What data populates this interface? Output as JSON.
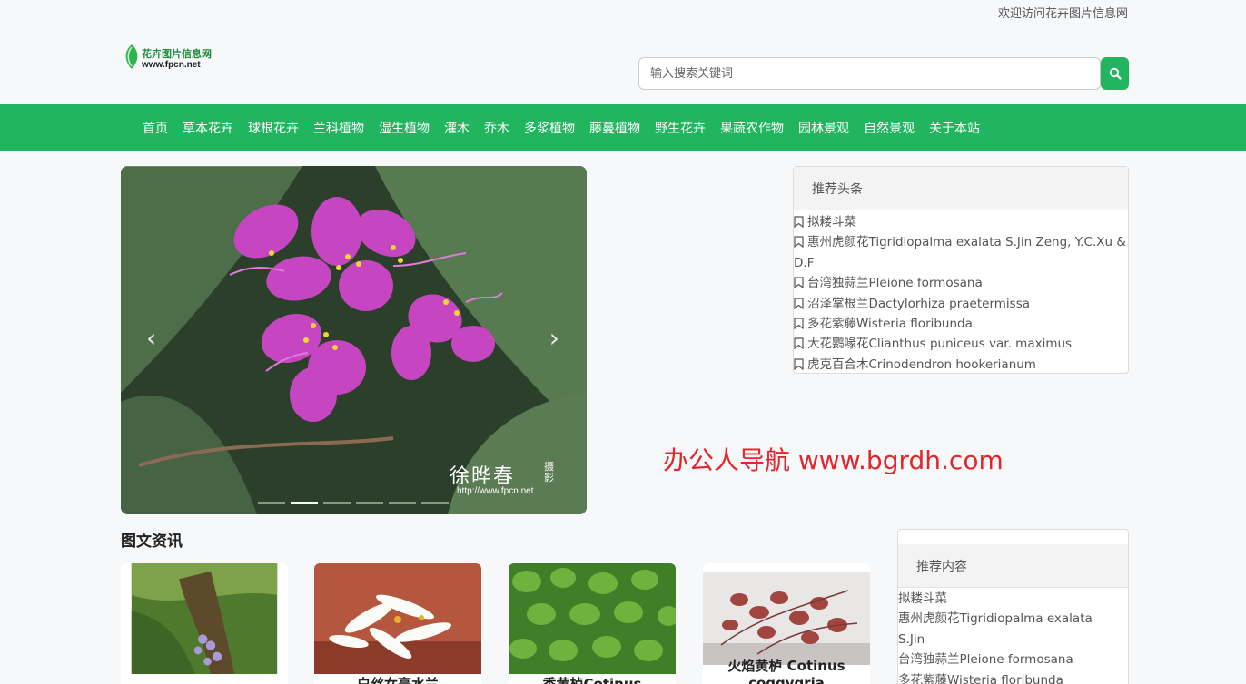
{
  "topbar": {
    "welcome": "欢迎访问花卉图片信息网"
  },
  "logo": {
    "name_cn": "花卉图片信息网",
    "domain": "www.fpcn.net"
  },
  "search": {
    "placeholder": "输入搜索关键词",
    "icon": "search-icon"
  },
  "nav": [
    "首页",
    "草本花卉",
    "球根花卉",
    "兰科植物",
    "湿生植物",
    "灌木",
    "乔木",
    "多浆植物",
    "藤蔓植物",
    "野生花卉",
    "果蔬农作物",
    "园林景观",
    "自然景观",
    "关于本站"
  ],
  "carousel": {
    "prev_icon": "chevron-left-icon",
    "next_icon": "chevron-right-icon",
    "watermark": "徐晔春",
    "watermark_mark": "摄影",
    "watermark_url": "http://www.fpcn.net",
    "slide_count": 6,
    "active_index": 1
  },
  "promo": "办公人导航 www.bgrdh.com",
  "headlines": {
    "title": "推荐头条",
    "items": [
      "拟耧斗菜",
      "惠州虎颜花Tigridiopalma exalata S.Jin Zeng, Y.C.Xu & D.F",
      "台湾独蒜兰Pleione formosana",
      "沼泽掌根兰Dactylorhiza praetermissa",
      "多花紫藤Wisteria floribunda",
      "大花鹦喙花Clianthus puniceus var. maximus",
      "虎克百合木Crinodendron hookerianum"
    ]
  },
  "news": {
    "title": "图文资讯",
    "cards": [
      {
        "caption": ""
      },
      {
        "caption": "白丝女亭水兰"
      },
      {
        "caption": "香黄栌Cotinus"
      },
      {
        "caption": "火焰黄栌 Cotinus coggygria"
      }
    ]
  },
  "recommend": {
    "title": "推荐内容",
    "items": [
      "拟耧斗菜",
      "惠州虎颜花Tigridiopalma exalata",
      "S.Jin",
      "台湾独蒜兰Pleione formosana",
      "多花紫藤Wisteria floribunda"
    ]
  },
  "colors": {
    "brand_green": "#22b55f",
    "promo_red": "#e3262b"
  }
}
